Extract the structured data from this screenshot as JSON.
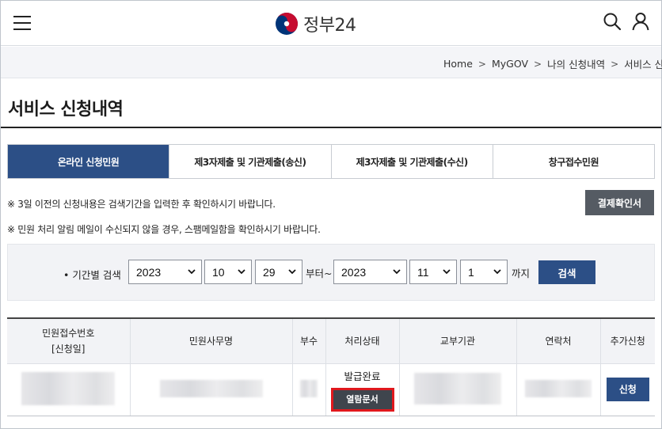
{
  "header": {
    "logo_text": "정부24",
    "brand_colors": {
      "red": "#c60c30",
      "blue": "#003478",
      "accent": "#2c4f86"
    },
    "icons": [
      "menu-icon",
      "search-icon",
      "user-icon"
    ]
  },
  "breadcrumb": {
    "items": [
      "Home",
      "MyGOV",
      "나의 신청내역",
      "서비스 신청내역"
    ]
  },
  "page": {
    "title": "서비스 신청내역"
  },
  "tabs": [
    {
      "label": "온라인 신청민원",
      "active": true
    },
    {
      "label": "제3자제출 및 기관제출(송신)",
      "active": false
    },
    {
      "label": "제3자제출 및 기관제출(수신)",
      "active": false
    },
    {
      "label": "창구접수민원",
      "active": false
    }
  ],
  "notices": {
    "line1": "※ 3일 이전의 신청내용은 검색기간을 입력한 후 확인하시기 바랍니다.",
    "line2": "※ 민원 처리 알림 메일이 수신되지 않을 경우, 스팸메일함을 확인하시기 바랍니다.",
    "confirm_button": "결제확인서"
  },
  "search": {
    "label": "기간별 검색",
    "from": {
      "year": "2023",
      "month": "10",
      "day": "29"
    },
    "to": {
      "year": "2023",
      "month": "11",
      "day": "1"
    },
    "joiner_from": "부터~",
    "joiner_to": "까지",
    "button": "검색"
  },
  "table": {
    "headers": {
      "receipt_no_line1": "민원접수번호",
      "receipt_no_line2": "[신청일]",
      "affair_name": "민원사무명",
      "copies": "부수",
      "status": "처리상태",
      "issuing_agency": "교부기관",
      "contact": "연락처",
      "extra_apply": "추가신청"
    },
    "rows": [
      {
        "status": "발급완료",
        "view_button": "열람문서",
        "apply_button": "신청"
      }
    ]
  }
}
